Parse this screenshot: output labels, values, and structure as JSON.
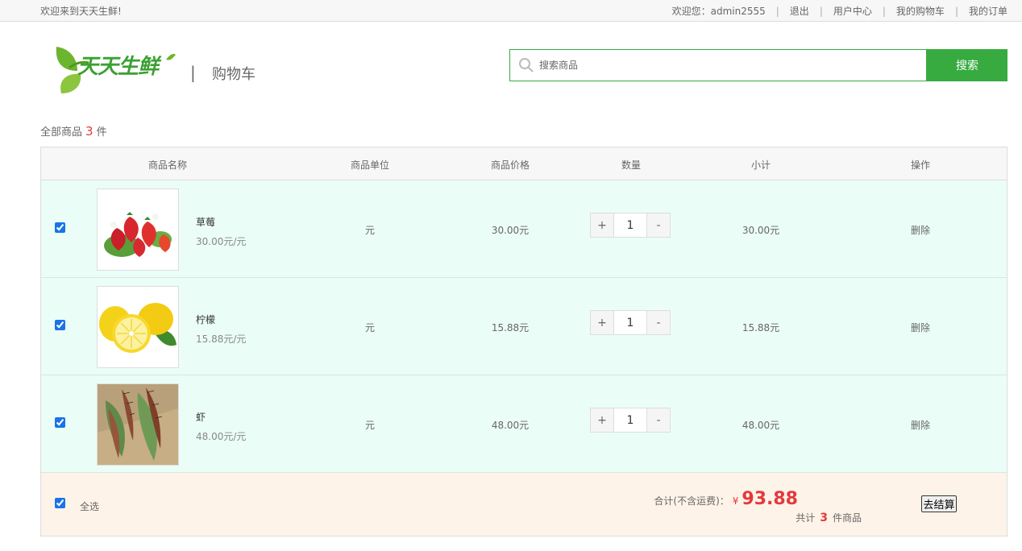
{
  "topbar": {
    "welcome": "欢迎来到天天生鲜!",
    "user_greeting": "欢迎您：admin2555",
    "links": [
      "退出",
      "用户中心",
      "我的购物车",
      "我的订单"
    ]
  },
  "header": {
    "logo_text": "天天生鲜",
    "separator": "|",
    "page_title": "购物车",
    "search_placeholder": "搜索商品",
    "search_button": "搜索",
    "accent_color": "#37ab40"
  },
  "summary": {
    "prefix": "全部商品",
    "count": "3",
    "suffix": "件"
  },
  "table": {
    "headers": [
      "商品名称",
      "商品单位",
      "商品价格",
      "数量",
      "小计",
      "操作"
    ],
    "rows": [
      {
        "name": "草莓",
        "unit_price": "30.00元/元",
        "unit": "元",
        "price": "30.00元",
        "qty": "1",
        "subtotal": "30.00元",
        "action": "删除",
        "checked": true,
        "image": "strawberry"
      },
      {
        "name": "柠檬",
        "unit_price": "15.88元/元",
        "unit": "元",
        "price": "15.88元",
        "qty": "1",
        "subtotal": "15.88元",
        "action": "删除",
        "checked": true,
        "image": "lemon"
      },
      {
        "name": "虾",
        "unit_price": "48.00元/元",
        "unit": "元",
        "price": "48.00元",
        "qty": "1",
        "subtotal": "48.00元",
        "action": "删除",
        "checked": true,
        "image": "shrimp"
      }
    ],
    "qty_plus": "+",
    "qty_minus": "-"
  },
  "footer": {
    "select_all": "全选",
    "total_label": "合计(不含运费)：",
    "currency": "¥",
    "total_amount": "93.88",
    "items_prefix": "共计",
    "items_count": "3",
    "items_suffix": "件商品",
    "checkout": "去结算"
  }
}
